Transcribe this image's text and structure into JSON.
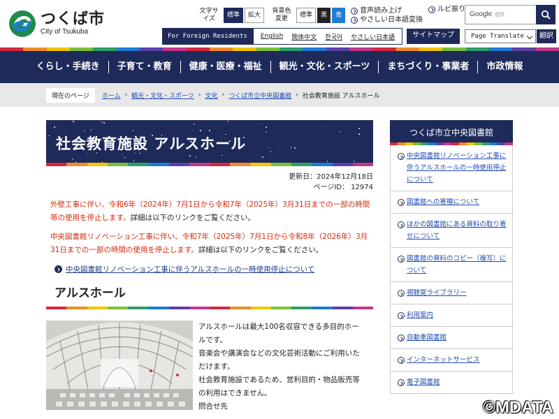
{
  "header": {
    "logo_jp": "つくば市",
    "logo_en": "City of Tsukuba",
    "text_size_label": "文字サイズ",
    "text_size_options": [
      "標準",
      "拡大"
    ],
    "bg_color_label": "背景色変更",
    "bg_color_options": [
      "標準",
      "黒",
      "青"
    ],
    "links": [
      "音声読み上げ",
      "やさしい日本語変換",
      "ルビ振り"
    ],
    "search_placeholder": "Google",
    "search_sub": "提供",
    "foreign_label": "For Foreign Residents",
    "languages": [
      "English",
      "簡体中文",
      "한국어",
      "やさしい日本語"
    ],
    "sitemap": "サイトマップ",
    "translate_select": "Page Translate",
    "translate_button": "翻訳"
  },
  "stripe_colors": [
    "#d7263d",
    "#f28c28",
    "#f2c500",
    "#7bbf3a",
    "#2e9e6a",
    "#1e7bd6",
    "#5b3fa8",
    "#c2378a"
  ],
  "nav": [
    "くらし・手続き",
    "子育て・教育",
    "健康・医療・福祉",
    "観光・文化・スポーツ",
    "まちづくり・事業者",
    "市政情報"
  ],
  "breadcrumb": {
    "here_label": "現在のページ",
    "items": [
      "ホーム",
      "観光・文化・スポーツ",
      "文化",
      "つくば市立中央図書館"
    ],
    "current": "社会教育施設 アルスホール"
  },
  "main": {
    "title": "社会教育施設 アルスホール",
    "updated": "更新日：2024年12月18日",
    "page_id": "ページID：  12974",
    "notice1_red": "外壁工事に伴い、令和6年（2024年）7月1日から令和7年（2025年）3月31日までの一部の時間帯の使用を停止します。",
    "notice1_black": "詳細は以下のリンクをご覧ください。",
    "notice2_red": "中央図書館リノベーション工事に伴い、令和7年（2025年）7月1日から令和8年（2026年）3月31日までの一部の時間の使用を停止します。",
    "notice2_black": "詳細は以下のリンクをご覧ください。",
    "link": "中央図書館リノベーション工事に伴うアルスホールの一時使用停止について",
    "section_heading": "アルスホール",
    "desc": [
      "アルスホールは最大100名収容できる多目的ホールです。",
      "音楽会や講演会などの文化芸術活動にご利用いただけます。",
      "社会教育施設であるため、営利目的・物品販売等の利用はできません。",
      "問合せ先"
    ]
  },
  "sidebar": {
    "title": "つくば市立中央図書館",
    "items": [
      "中央図書館リノベーション工事に伴うアルスホールの一時使用停止について",
      "図書館への寄贈について",
      "ほかの図書館にある資料の取り寄せについて",
      "図書館の資料のコピー（複写）について",
      "視聴覚ライブラリー",
      "利用案内",
      "自動車図書館",
      "インターネットサービス",
      "電子図書館"
    ]
  },
  "watermark": "©MDATA"
}
